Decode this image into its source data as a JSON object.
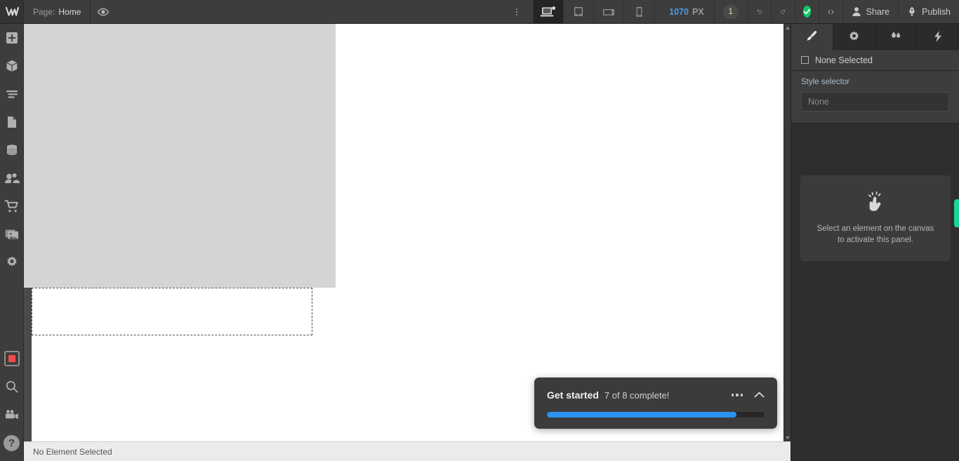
{
  "topbar": {
    "logo_icon": "webflow-logo-icon",
    "page_label": "Page:",
    "page_name": "Home",
    "preview_icon": "eye-icon",
    "more_icon": "vertical-dots-icon",
    "devices": [
      {
        "name": "desktop",
        "icon": "desktop-breakpoint-icon",
        "active": true
      },
      {
        "name": "tablet",
        "icon": "tablet-breakpoint-icon",
        "active": false
      },
      {
        "name": "mobile-landscape",
        "icon": "mobile-landscape-breakpoint-icon",
        "active": false
      },
      {
        "name": "mobile-portrait",
        "icon": "mobile-portrait-breakpoint-icon",
        "active": false
      }
    ],
    "canvas_width": "1070",
    "canvas_unit": "PX",
    "badge_count": "1",
    "undo_icon": "undo-icon",
    "redo_icon": "redo-icon",
    "save_icon": "checkmark-saved-icon",
    "code_icon": "code-brackets-icon",
    "share_label": "Share",
    "publish_label": "Publish"
  },
  "sidebar": {
    "items": [
      {
        "name": "add-elements",
        "icon": "plus-square-icon"
      },
      {
        "name": "components",
        "icon": "cube-icon"
      },
      {
        "name": "navigator",
        "icon": "navigator-lines-icon"
      },
      {
        "name": "pages",
        "icon": "page-document-icon"
      },
      {
        "name": "cms",
        "icon": "database-icon"
      },
      {
        "name": "users",
        "icon": "people-icon"
      },
      {
        "name": "ecommerce",
        "icon": "shopping-cart-icon"
      },
      {
        "name": "assets",
        "icon": "images-icon"
      },
      {
        "name": "settings",
        "icon": "gear-icon"
      }
    ],
    "bottom_items": [
      {
        "name": "audit",
        "icon": "audit-red-square-icon"
      },
      {
        "name": "search",
        "icon": "magnifier-icon"
      },
      {
        "name": "video",
        "icon": "video-camera-icon"
      },
      {
        "name": "help",
        "icon": "question-mark-icon",
        "glyph": "?"
      }
    ]
  },
  "canvas": {
    "scroll_up_icon": "scroll-arrow-up-icon",
    "scroll_down_icon": "scroll-arrow-down-icon"
  },
  "get_started": {
    "title": "Get started",
    "subtitle": "7 of 8 complete!",
    "more_icon": "ellipsis-icon",
    "collapse_icon": "chevron-up-icon",
    "progress_percent": 87,
    "progress_color": "#2b93f0"
  },
  "right_panel": {
    "tabs": [
      {
        "name": "style",
        "icon": "paintbrush-icon",
        "active": true
      },
      {
        "name": "settings",
        "icon": "gear-icon",
        "active": false
      },
      {
        "name": "interactions",
        "icon": "water-drops-icon",
        "active": false
      },
      {
        "name": "effects",
        "icon": "lightning-bolt-icon",
        "active": false
      }
    ],
    "selection_icon": "square-outline-icon",
    "selection_label": "None Selected",
    "style_selector_label": "Style selector",
    "style_selector_placeholder": "None",
    "empty_icon": "tap-hand-icon",
    "empty_text_line1": "Select an element on the canvas",
    "empty_text_line2": "to activate this panel.",
    "edge_tab_color": "#1ad598"
  },
  "statusbar": {
    "text": "No Element Selected"
  }
}
